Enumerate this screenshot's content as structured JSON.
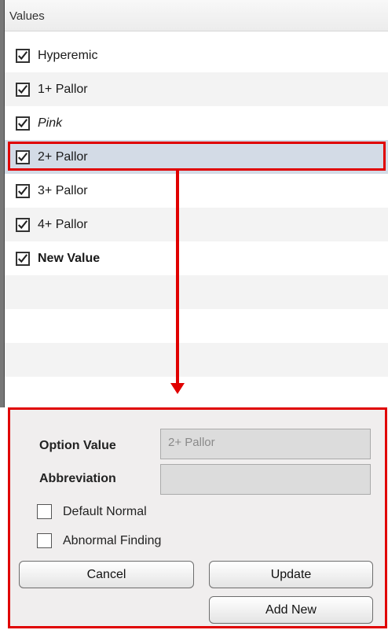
{
  "list": {
    "header": "Values",
    "items": [
      {
        "label": "Hyperemic",
        "checked": true,
        "style": "normal"
      },
      {
        "label": "1+ Pallor",
        "checked": true,
        "style": "normal"
      },
      {
        "label": "Pink",
        "checked": true,
        "style": "italic"
      },
      {
        "label": "2+ Pallor",
        "checked": true,
        "style": "normal",
        "selected": true
      },
      {
        "label": "3+ Pallor",
        "checked": true,
        "style": "normal"
      },
      {
        "label": "4+ Pallor",
        "checked": true,
        "style": "normal"
      },
      {
        "label": "New Value",
        "checked": true,
        "style": "bold"
      }
    ]
  },
  "editor": {
    "option_value_label": "Option Value",
    "option_value": "2+ Pallor",
    "abbreviation_label": "Abbreviation",
    "abbreviation": "",
    "default_normal_label": "Default Normal",
    "default_normal_checked": false,
    "abnormal_finding_label": "Abnormal Finding",
    "abnormal_finding_checked": false,
    "cancel_label": "Cancel",
    "update_label": "Update",
    "add_new_label": "Add New"
  },
  "colors": {
    "highlight": "#e00000",
    "selected_row": "#d3dbe6"
  }
}
